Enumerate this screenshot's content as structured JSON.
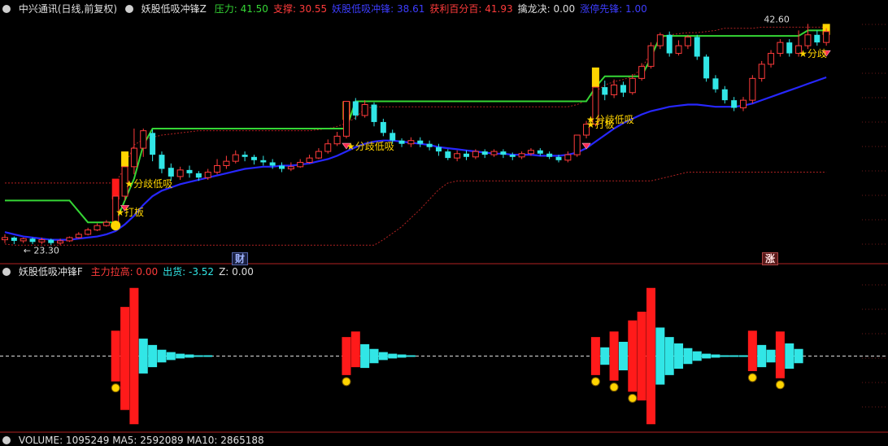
{
  "header": {
    "stock": "中兴通讯(日线,前复权)",
    "indicator": "妖股低吸冲锋Z",
    "items": [
      {
        "label": "压力:",
        "value": "41.50",
        "color": "#35d635"
      },
      {
        "label": "支撑:",
        "value": "30.55",
        "color": "#ff3b3b"
      },
      {
        "label": "妖股低吸冲锋:",
        "value": "38.61",
        "color": "#3d3dff"
      },
      {
        "label": "获利百分百:",
        "value": "41.93",
        "color": "#ff3b3b"
      },
      {
        "label": "擒龙决:",
        "value": "0.00",
        "color": "#dddddd"
      },
      {
        "label": "涨停先锋:",
        "value": "1.00",
        "color": "#3d3dff"
      }
    ]
  },
  "sub_header": {
    "indicator": "妖股低吸冲锋F",
    "items": [
      {
        "label": "主力拉高:",
        "value": "0.00",
        "color": "#ff3b3b"
      },
      {
        "label": "出货:",
        "value": "-3.52",
        "color": "#31e6e6"
      },
      {
        "label": "Z:",
        "value": "0.00",
        "color": "#dddddd"
      }
    ]
  },
  "vol_header": {
    "text": "VOLUME: 1095249 MA5: 2592089 MA10: 2865188"
  },
  "markers": {
    "cai": "财",
    "zhang": "涨"
  },
  "chart_data": [
    {
      "type": "candlestick",
      "panel": "main",
      "annotations": {
        "high_label": "42.60",
        "low_label": "23.30"
      },
      "signals": [
        {
          "x": 12,
          "text": "★打板"
        },
        {
          "x": 13,
          "text": "★分歧低吸"
        },
        {
          "x": 37,
          "text": "★分歧低吸"
        },
        {
          "x": 63,
          "text": "★分歧低吸"
        },
        {
          "x": 63,
          "text": "★打板"
        },
        {
          "x": 86,
          "text": "★分歧"
        }
      ],
      "candles": [
        [
          22.8,
          23.0,
          22.5,
          23.3
        ],
        [
          23.0,
          22.7,
          22.4,
          23.1
        ],
        [
          22.7,
          22.9,
          22.5,
          23.0
        ],
        [
          22.9,
          22.6,
          22.4,
          23.0
        ],
        [
          22.6,
          22.8,
          22.4,
          23.0
        ],
        [
          22.8,
          22.5,
          22.3,
          22.9
        ],
        [
          22.5,
          22.7,
          22.3,
          22.9
        ],
        [
          22.7,
          23.0,
          22.6,
          23.1
        ],
        [
          23.0,
          23.3,
          22.9,
          23.5
        ],
        [
          23.3,
          23.7,
          23.2,
          23.9
        ],
        [
          23.7,
          24.1,
          23.6,
          24.3
        ],
        [
          24.1,
          24.4,
          24.0,
          24.6
        ],
        [
          24.4,
          26.8,
          24.3,
          26.8
        ],
        [
          26.8,
          29.5,
          26.4,
          29.5
        ],
        [
          29.5,
          31.2,
          28.8,
          33.0
        ],
        [
          31.2,
          32.8,
          30.4,
          33.0
        ],
        [
          32.6,
          30.6,
          30.0,
          32.9
        ],
        [
          30.6,
          29.3,
          28.9,
          30.9
        ],
        [
          29.4,
          28.6,
          28.2,
          29.8
        ],
        [
          28.6,
          29.2,
          28.3,
          29.5
        ],
        [
          29.2,
          28.9,
          28.5,
          29.6
        ],
        [
          28.9,
          28.5,
          28.2,
          29.1
        ],
        [
          28.5,
          29.0,
          28.3,
          29.3
        ],
        [
          29.0,
          29.6,
          28.8,
          30.2
        ],
        [
          29.6,
          30.0,
          29.3,
          30.5
        ],
        [
          30.0,
          30.6,
          29.8,
          31.0
        ],
        [
          30.6,
          30.4,
          30.0,
          30.9
        ],
        [
          30.4,
          30.1,
          29.7,
          30.6
        ],
        [
          30.1,
          29.9,
          29.6,
          30.5
        ],
        [
          29.9,
          29.6,
          29.3,
          30.2
        ],
        [
          29.6,
          29.3,
          29.0,
          29.9
        ],
        [
          29.3,
          29.5,
          29.1,
          29.9
        ],
        [
          29.5,
          29.9,
          29.4,
          30.2
        ],
        [
          29.9,
          30.3,
          29.8,
          30.6
        ],
        [
          30.3,
          30.9,
          30.2,
          31.2
        ],
        [
          30.9,
          31.6,
          30.7,
          32.0
        ],
        [
          31.6,
          32.3,
          31.4,
          32.7
        ],
        [
          32.3,
          35.5,
          32.1,
          35.5
        ],
        [
          35.5,
          34.2,
          33.8,
          35.8
        ],
        [
          34.2,
          35.2,
          34.0,
          35.6
        ],
        [
          35.2,
          33.6,
          33.2,
          35.4
        ],
        [
          33.6,
          32.6,
          32.3,
          33.9
        ],
        [
          32.6,
          31.9,
          31.6,
          32.9
        ],
        [
          31.9,
          31.6,
          31.3,
          32.1
        ],
        [
          31.6,
          31.9,
          31.3,
          32.2
        ],
        [
          31.9,
          31.6,
          31.3,
          32.2
        ],
        [
          31.6,
          31.3,
          31.0,
          31.9
        ],
        [
          31.3,
          30.9,
          30.5,
          31.6
        ],
        [
          30.9,
          30.3,
          30.1,
          31.1
        ],
        [
          30.3,
          30.7,
          30.0,
          31.0
        ],
        [
          30.7,
          30.4,
          30.1,
          31.0
        ],
        [
          30.4,
          30.9,
          30.2,
          31.1
        ],
        [
          30.9,
          30.6,
          30.3,
          31.1
        ],
        [
          30.6,
          30.9,
          30.4,
          31.1
        ],
        [
          30.9,
          30.6,
          30.3,
          31.1
        ],
        [
          30.6,
          30.4,
          30.1,
          30.8
        ],
        [
          30.4,
          30.7,
          30.2,
          30.9
        ],
        [
          30.7,
          31.0,
          30.5,
          31.2
        ],
        [
          31.0,
          30.7,
          30.5,
          31.2
        ],
        [
          30.7,
          30.4,
          30.2,
          30.9
        ],
        [
          30.4,
          30.1,
          29.9,
          30.6
        ],
        [
          30.1,
          30.6,
          29.9,
          30.9
        ],
        [
          30.6,
          32.4,
          30.4,
          32.4
        ],
        [
          32.4,
          33.4,
          32.1,
          33.7
        ],
        [
          33.4,
          36.8,
          33.2,
          36.8
        ],
        [
          36.8,
          36.1,
          35.6,
          37.4
        ],
        [
          36.1,
          37.0,
          35.8,
          37.5
        ],
        [
          37.0,
          36.3,
          35.9,
          37.3
        ],
        [
          36.3,
          37.6,
          36.1,
          38.0
        ],
        [
          37.6,
          38.7,
          37.4,
          39.0
        ],
        [
          38.7,
          40.6,
          38.5,
          40.9
        ],
        [
          40.6,
          41.6,
          40.3,
          41.8
        ],
        [
          41.6,
          39.9,
          39.6,
          41.9
        ],
        [
          39.9,
          40.6,
          39.7,
          41.1
        ],
        [
          40.6,
          41.4,
          40.3,
          41.6
        ],
        [
          41.4,
          39.6,
          39.3,
          41.6
        ],
        [
          39.6,
          37.6,
          37.3,
          39.8
        ],
        [
          37.6,
          36.6,
          36.3,
          37.9
        ],
        [
          36.6,
          35.6,
          35.3,
          36.9
        ],
        [
          35.6,
          34.9,
          34.6,
          35.9
        ],
        [
          34.9,
          35.6,
          34.6,
          35.9
        ],
        [
          35.6,
          37.6,
          35.3,
          37.9
        ],
        [
          37.6,
          38.9,
          37.3,
          39.2
        ],
        [
          38.9,
          39.9,
          38.6,
          40.2
        ],
        [
          39.9,
          40.9,
          39.6,
          41.2
        ],
        [
          40.9,
          39.9,
          39.6,
          41.2
        ],
        [
          39.9,
          40.6,
          39.6,
          42.0
        ],
        [
          40.6,
          41.6,
          40.3,
          42.6
        ],
        [
          41.6,
          40.9,
          40.6,
          42.0
        ],
        [
          40.9,
          41.9,
          40.6,
          42.2
        ]
      ],
      "ma_line": [
        23.5,
        23.3,
        23.1,
        23.0,
        22.9,
        22.8,
        22.8,
        22.8,
        22.9,
        23.0,
        23.1,
        23.3,
        23.6,
        24.2,
        25.0,
        26.0,
        26.8,
        27.3,
        27.6,
        27.9,
        28.1,
        28.3,
        28.5,
        28.7,
        28.9,
        29.1,
        29.3,
        29.4,
        29.5,
        29.5,
        29.6,
        29.6,
        29.7,
        29.8,
        30.0,
        30.2,
        30.5,
        30.9,
        31.3,
        31.6,
        31.8,
        31.9,
        31.9,
        31.8,
        31.7,
        31.6,
        31.5,
        31.3,
        31.2,
        31.1,
        31.0,
        30.9,
        30.8,
        30.7,
        30.7,
        30.6,
        30.6,
        30.6,
        30.5,
        30.5,
        30.5,
        30.6,
        30.8,
        31.2,
        31.8,
        32.4,
        33.0,
        33.5,
        33.9,
        34.3,
        34.6,
        34.8,
        35.0,
        35.1,
        35.2,
        35.2,
        35.1,
        35.0,
        35.0,
        35.0,
        35.1,
        35.3,
        35.6,
        35.9,
        36.2,
        36.5,
        36.8,
        37.1,
        37.4,
        37.7
      ],
      "pressure_line": [
        26.4,
        26.4,
        26.4,
        26.4,
        26.4,
        26.4,
        26.4,
        26.4,
        25.4,
        24.4,
        24.4,
        24.4,
        24.4,
        26.4,
        28.4,
        31.5,
        33.0,
        33.0,
        33.0,
        33.0,
        33.0,
        33.0,
        33.0,
        33.0,
        33.0,
        33.0,
        33.0,
        33.0,
        33.0,
        33.0,
        33.0,
        33.0,
        33.0,
        33.0,
        33.0,
        33.0,
        33.0,
        33.0,
        35.5,
        35.5,
        35.5,
        35.5,
        35.5,
        35.5,
        35.5,
        35.5,
        35.5,
        35.5,
        35.5,
        35.5,
        35.5,
        35.5,
        35.5,
        35.5,
        35.5,
        35.5,
        35.5,
        35.5,
        35.5,
        35.5,
        35.5,
        35.5,
        35.5,
        35.5,
        36.8,
        37.8,
        37.8,
        37.8,
        37.8,
        37.8,
        39.5,
        41.5,
        41.5,
        41.5,
        41.5,
        41.5,
        41.5,
        41.5,
        41.5,
        41.5,
        41.5,
        41.5,
        41.5,
        41.5,
        41.5,
        41.5,
        41.5,
        42.0,
        42.0,
        42.0
      ],
      "support_upper": [
        28.0,
        28.0,
        28.0,
        28.0,
        28.0,
        28.0,
        28.0,
        28.0,
        28.0,
        28.0,
        28.0,
        28.0,
        28.0,
        29.5,
        31.5,
        32.0,
        32.2,
        32.4,
        32.5,
        32.6,
        32.7,
        32.8,
        32.8,
        32.8,
        32.8,
        32.8,
        32.8,
        32.8,
        32.8,
        32.8,
        32.8,
        32.8,
        32.8,
        32.8,
        32.9,
        33.0,
        33.2,
        33.5,
        34.0,
        34.8,
        35.0,
        35.0,
        35.0,
        35.0,
        35.0,
        35.0,
        35.0,
        35.0,
        35.0,
        35.0,
        35.0,
        35.0,
        35.0,
        35.0,
        35.0,
        35.0,
        35.0,
        35.0,
        35.0,
        35.0,
        35.0,
        35.0,
        35.2,
        35.6,
        36.4,
        37.0,
        37.3,
        37.5,
        37.8,
        38.5,
        40.0,
        41.3,
        41.6,
        41.7,
        41.8,
        41.8,
        41.9,
        42.0,
        42.2,
        42.2,
        42.2,
        42.2,
        42.3,
        42.3,
        42.3,
        42.3,
        42.3,
        42.3,
        42.3,
        42.3
      ],
      "support_lower": [
        22.4,
        22.3,
        22.3,
        22.3,
        22.3,
        22.3,
        22.3,
        22.3,
        22.3,
        22.3,
        22.3,
        22.3,
        22.3,
        22.3,
        22.3,
        22.3,
        22.3,
        22.3,
        22.3,
        22.3,
        22.3,
        22.3,
        22.3,
        22.3,
        22.3,
        22.3,
        22.3,
        22.3,
        22.3,
        22.3,
        22.3,
        22.3,
        22.3,
        22.3,
        22.3,
        22.3,
        22.3,
        22.3,
        22.3,
        22.3,
        22.3,
        22.8,
        23.4,
        24.0,
        24.8,
        25.6,
        26.5,
        27.4,
        28.0,
        28.2,
        28.2,
        28.2,
        28.2,
        28.2,
        28.2,
        28.2,
        28.2,
        28.2,
        28.2,
        28.2,
        28.2,
        28.2,
        28.2,
        28.2,
        28.2,
        28.2,
        28.2,
        28.2,
        28.2,
        28.2,
        28.2,
        28.4,
        28.6,
        28.8,
        29.0,
        29.0,
        29.0,
        29.0,
        29.0,
        29.0,
        29.0,
        29.0,
        29.0,
        29.0,
        29.0,
        29.0,
        29.0,
        29.0,
        29.0,
        29.0
      ],
      "yellow_bars": [
        [
          13,
          29.5,
          30.9
        ],
        [
          37,
          33.8,
          35.5
        ],
        [
          64,
          36.8,
          38.6
        ],
        [
          89,
          41.6,
          42.6
        ]
      ],
      "red_bars": [
        [
          12,
          26.5,
          28.4
        ]
      ],
      "ylim": [
        21.5,
        43.3
      ]
    },
    {
      "type": "bar",
      "panel": "sub",
      "ylim": [
        -9.5,
        9.5
      ],
      "red": [
        [
          12,
          3.2,
          -3.2
        ],
        [
          13,
          6.2,
          -6.8
        ],
        [
          14,
          8.6,
          -8.6
        ],
        [
          37,
          2.4,
          -2.4
        ],
        [
          38,
          3.1,
          -1.4
        ],
        [
          64,
          2.4,
          -2.4
        ],
        [
          66,
          3.1,
          -3.1
        ],
        [
          68,
          4.5,
          -4.5
        ],
        [
          69,
          5.6,
          -5.6
        ],
        [
          70,
          8.6,
          -8.6
        ],
        [
          81,
          3.2,
          -1.9
        ],
        [
          84,
          3.1,
          -2.8
        ]
      ],
      "cyan": [
        [
          15,
          2.2,
          -2.2
        ],
        [
          16,
          1.4,
          -1.4
        ],
        [
          17,
          0.8,
          -0.8
        ],
        [
          18,
          0.5,
          -0.5
        ],
        [
          19,
          0.3,
          -0.3
        ],
        [
          20,
          0.2,
          -0.2
        ],
        [
          21,
          0.1,
          -0.1
        ],
        [
          22,
          0.1,
          -0.1
        ],
        [
          39,
          1.5,
          -1.5
        ],
        [
          40,
          0.9,
          -0.9
        ],
        [
          41,
          0.5,
          -0.5
        ],
        [
          42,
          0.3,
          -0.3
        ],
        [
          43,
          0.2,
          -0.2
        ],
        [
          44,
          0.1,
          -0.1
        ],
        [
          65,
          1.1,
          -1.1
        ],
        [
          67,
          1.8,
          -1.8
        ],
        [
          71,
          3.6,
          -3.6
        ],
        [
          72,
          2.4,
          -2.4
        ],
        [
          73,
          1.6,
          -1.6
        ],
        [
          74,
          1.0,
          -1.0
        ],
        [
          75,
          0.6,
          -0.6
        ],
        [
          76,
          0.3,
          -0.3
        ],
        [
          77,
          0.2,
          -0.2
        ],
        [
          78,
          0.1,
          -0.1
        ],
        [
          79,
          0.1,
          -0.1
        ],
        [
          80,
          0.1,
          -0.1
        ],
        [
          82,
          1.4,
          -1.4
        ],
        [
          83,
          0.8,
          -0.8
        ],
        [
          85,
          1.6,
          -1.6
        ],
        [
          86,
          0.9,
          -0.9
        ]
      ],
      "money_bags": [
        [
          12,
          -3.2
        ],
        [
          37,
          -2.4
        ],
        [
          64,
          -2.4
        ],
        [
          66,
          -3.1
        ],
        [
          68,
          -4.5
        ],
        [
          81,
          -1.9
        ],
        [
          84,
          -2.8
        ]
      ]
    }
  ]
}
